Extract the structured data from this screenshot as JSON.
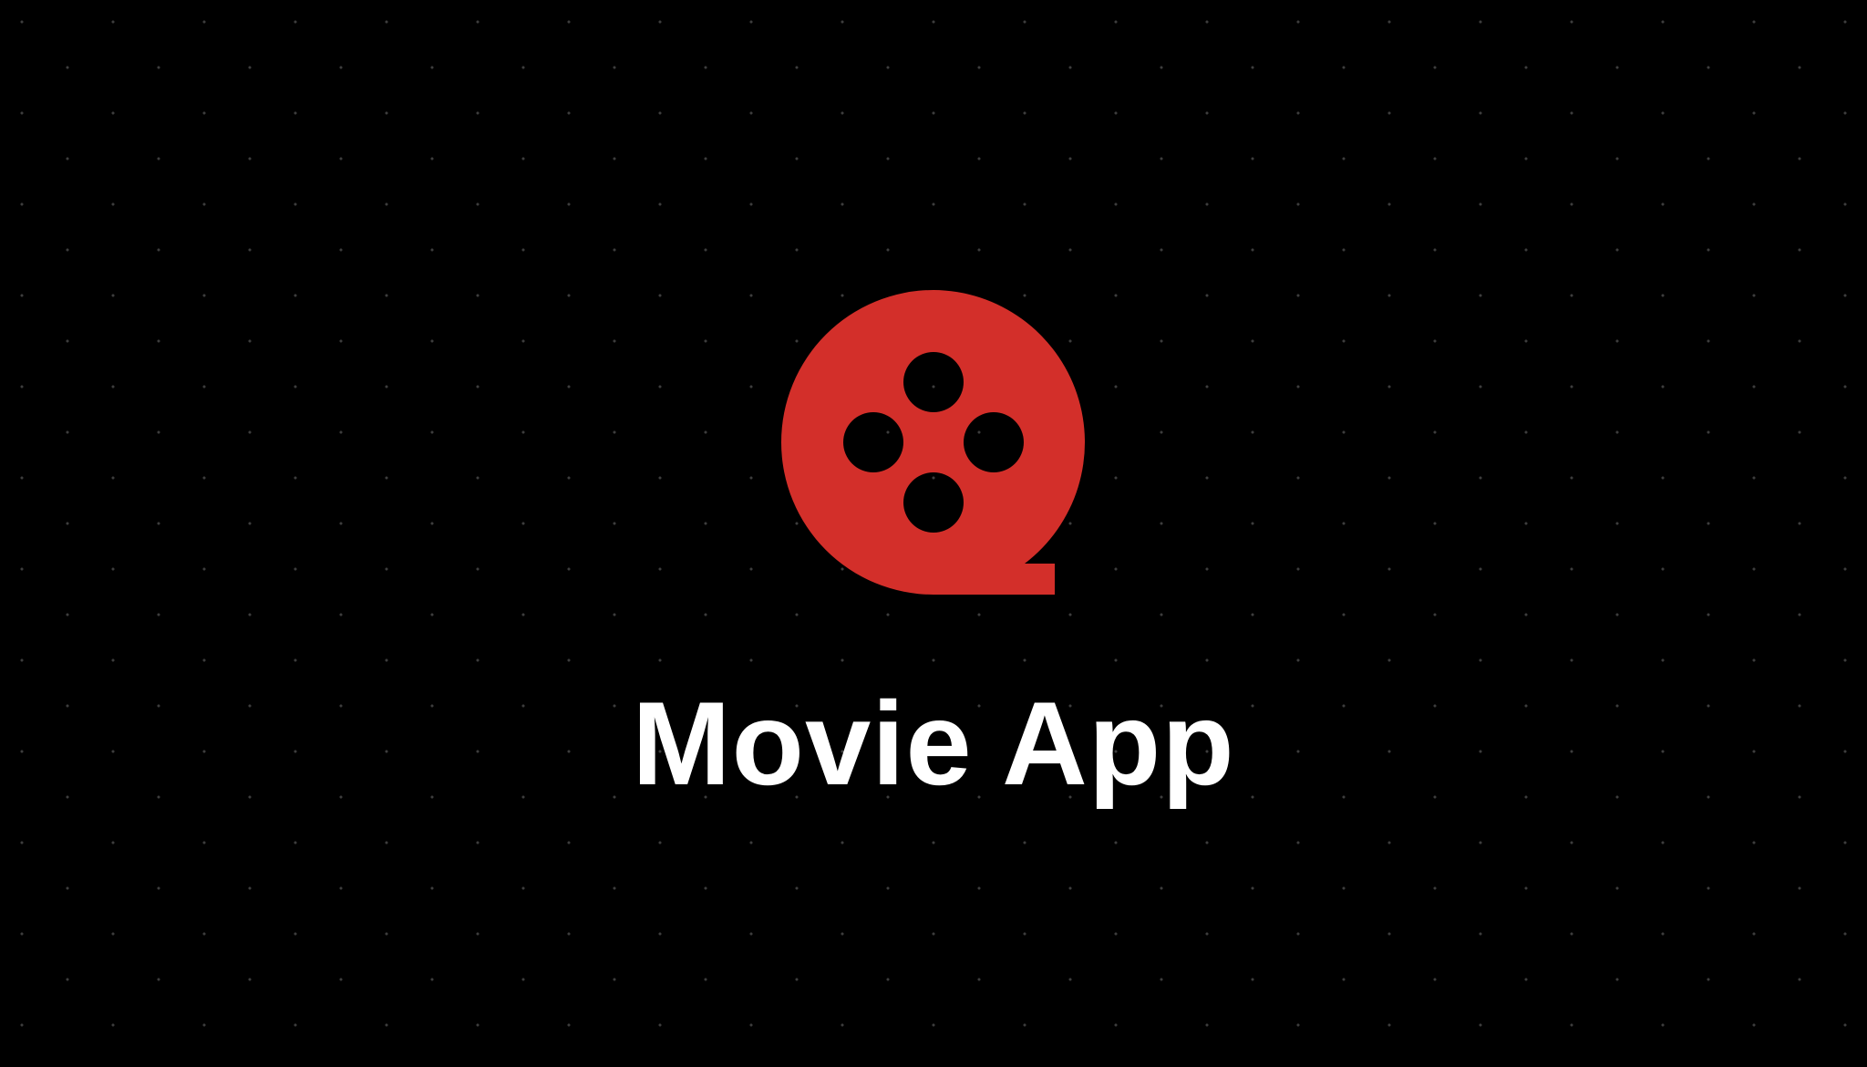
{
  "app": {
    "title": "Movie App"
  },
  "logo": {
    "icon": "film-reel-icon",
    "color": "#d32f2a"
  },
  "theme": {
    "background": "#000000",
    "text_color": "#ffffff",
    "dot_color": "#3d3d3d"
  }
}
